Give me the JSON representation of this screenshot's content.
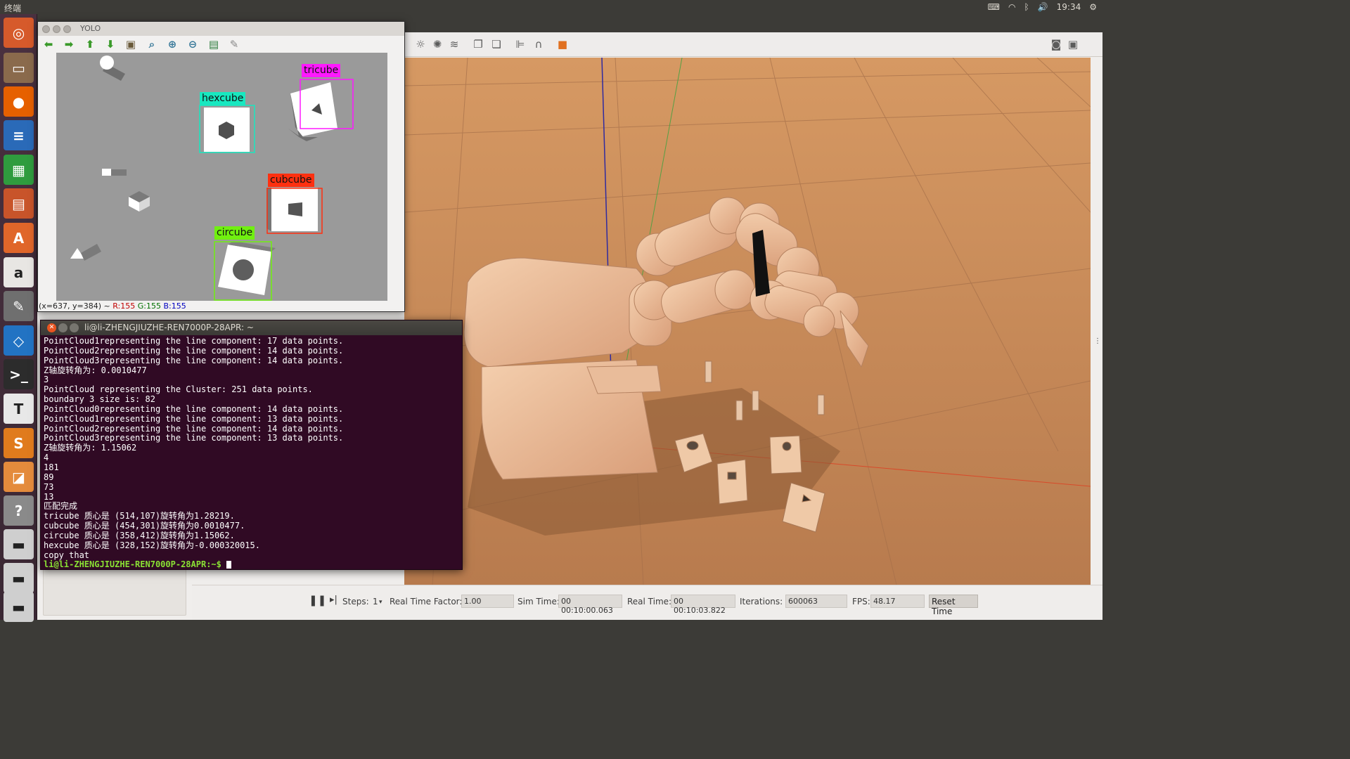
{
  "top_panel": {
    "title": "终端",
    "clock": "19:34"
  },
  "launcher": {
    "items": [
      {
        "name": "ubuntu-dash",
        "glyph": "◎",
        "color": "#d65a2b"
      },
      {
        "name": "files",
        "glyph": "▭",
        "color": "#8a6a4c"
      },
      {
        "name": "firefox",
        "glyph": "●",
        "color": "#e66000"
      },
      {
        "name": "writer",
        "glyph": "≡",
        "color": "#2a6ab8"
      },
      {
        "name": "calc",
        "glyph": "▦",
        "color": "#2f9c3e"
      },
      {
        "name": "impress",
        "glyph": "▤",
        "color": "#c8542a"
      },
      {
        "name": "software-center",
        "glyph": "A",
        "color": "#e0662a"
      },
      {
        "name": "amazon",
        "glyph": "a",
        "color": "#e8e6e3"
      },
      {
        "name": "system-settings",
        "glyph": "✎",
        "color": "#6f6f6f"
      },
      {
        "name": "vscode",
        "glyph": "◇",
        "color": "#2273c3"
      },
      {
        "name": "terminal",
        "glyph": ">_",
        "color": "#2c2c2c"
      },
      {
        "name": "typora",
        "glyph": "T",
        "color": "#e8e8e8"
      },
      {
        "name": "sublime",
        "glyph": "S",
        "color": "#e07b1d"
      },
      {
        "name": "gazebo",
        "glyph": "◪",
        "color": "#e48b3c"
      },
      {
        "name": "help",
        "glyph": "?",
        "color": "#8a8a8a"
      },
      {
        "name": "disk-1",
        "glyph": "▬",
        "color": "#cfcfcf"
      },
      {
        "name": "disk-2",
        "glyph": "▬",
        "color": "#cfcfcf"
      },
      {
        "name": "disk-3",
        "glyph": "▬",
        "color": "#cfcfcf"
      }
    ]
  },
  "yolo": {
    "title": "YOLO",
    "detections": [
      {
        "label": "hexcube",
        "color": "#18e8c0"
      },
      {
        "label": "tricube",
        "color": "#ff18ff"
      },
      {
        "label": "cubcube",
        "color": "#ff3010"
      },
      {
        "label": "circube",
        "color": "#70f010"
      }
    ],
    "status": {
      "coords": "(x=637, y=384) ~ ",
      "r": "R:155",
      "g": "G:155",
      "b": "B:155"
    }
  },
  "terminal": {
    "title": "li@li-ZHENGJIUZHE-REN7000P-28APR: ~",
    "lines": [
      "PointCloud1representing the line component: 17 data points.",
      "PointCloud2representing the line component: 14 data points.",
      "PointCloud3representing the line component: 14 data points.",
      "Z轴旋转角为: 0.0010477",
      "3",
      "PointCloud representing the Cluster: 251 data points.",
      "boundary 3 size is: 82",
      "PointCloud0representing the line component: 14 data points.",
      "PointCloud1representing the line component: 13 data points.",
      "PointCloud2representing the line component: 14 data points.",
      "PointCloud3representing the line component: 13 data points.",
      "Z轴旋转角为: 1.15062",
      "4",
      "181",
      "89",
      "73",
      "13",
      "匹配完成",
      "tricube 质心是 (514,107)旋转角为1.28219.",
      "cubcube 质心是 (454,301)旋转角为0.0010477.",
      "circube 质心是 (358,412)旋转角为1.15062.",
      "hexcube 质心是 (328,152)旋转角为-0.000320015.",
      "copy that"
    ],
    "prompt": "li@li-ZHENGJIUZHE-REN7000P-28APR:~$ "
  },
  "gazebo": {
    "bottom": {
      "steps_label": "Steps:",
      "steps_value": "1",
      "rtf_label": "Real Time Factor:",
      "rtf_value": "1.00",
      "sim_label": "Sim Time:",
      "sim_value": "00 00:10:00.063",
      "real_label": "Real Time:",
      "real_value": "00 00:10:03.822",
      "iter_label": "Iterations:",
      "iter_value": "600063",
      "fps_label": "FPS:",
      "fps_value": "48.17",
      "reset_label": "Reset Time"
    }
  }
}
